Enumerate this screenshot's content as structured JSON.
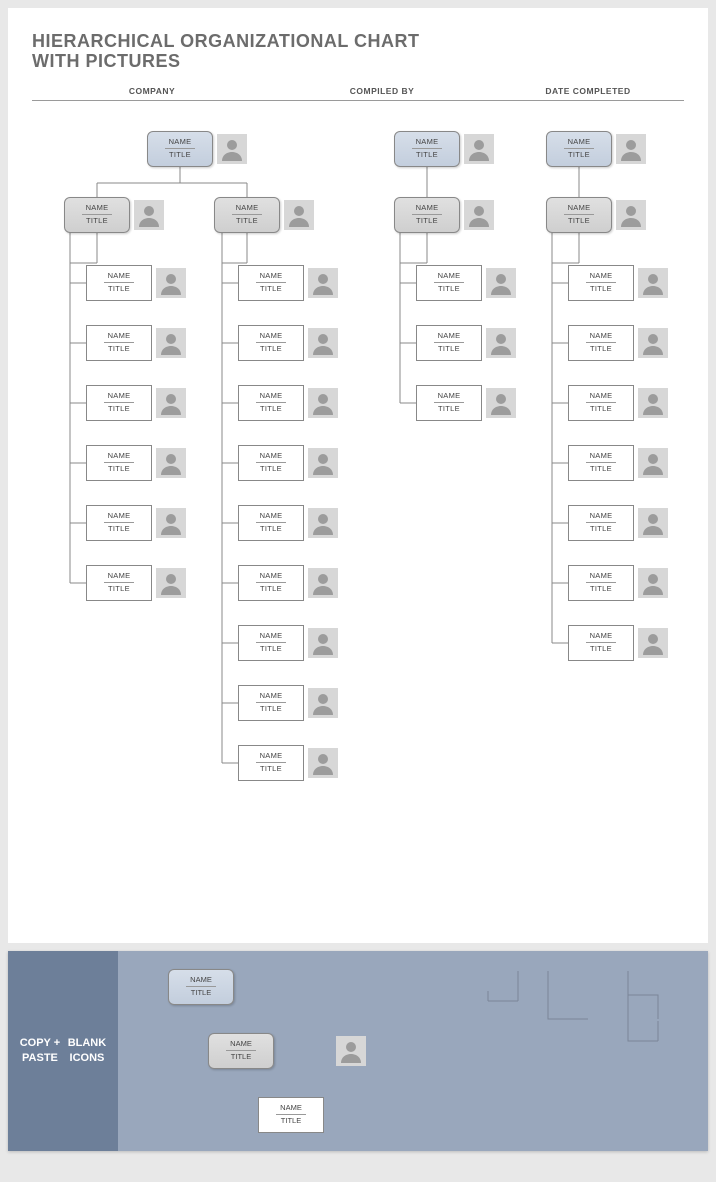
{
  "doc": {
    "title_line1": "HIERARCHICAL ORGANIZATIONAL CHART",
    "title_line2": "WITH PICTURES"
  },
  "headers": {
    "company": "COMPANY",
    "compiled_by": "COMPILED BY",
    "date_completed": "DATE COMPLETED"
  },
  "labels": {
    "name_ph": "NAME",
    "title_ph": "TITLE"
  },
  "palette": {
    "label_line1": "COPY + PASTE",
    "label_line2": "BLANK ICONS"
  },
  "chart_data": {
    "type": "org-chart",
    "title": "Hierarchical Organizational Chart With Pictures",
    "trees": [
      {
        "root": {
          "name": "NAME",
          "title": "TITLE",
          "level": "top"
        },
        "children": [
          {
            "node": {
              "name": "NAME",
              "title": "TITLE",
              "level": "mid"
            },
            "children": [
              {
                "name": "NAME",
                "title": "TITLE"
              },
              {
                "name": "NAME",
                "title": "TITLE"
              },
              {
                "name": "NAME",
                "title": "TITLE"
              },
              {
                "name": "NAME",
                "title": "TITLE"
              },
              {
                "name": "NAME",
                "title": "TITLE"
              },
              {
                "name": "NAME",
                "title": "TITLE"
              }
            ]
          },
          {
            "node": {
              "name": "NAME",
              "title": "TITLE",
              "level": "mid"
            },
            "children": [
              {
                "name": "NAME",
                "title": "TITLE"
              },
              {
                "name": "NAME",
                "title": "TITLE"
              },
              {
                "name": "NAME",
                "title": "TITLE"
              },
              {
                "name": "NAME",
                "title": "TITLE"
              },
              {
                "name": "NAME",
                "title": "TITLE"
              },
              {
                "name": "NAME",
                "title": "TITLE"
              },
              {
                "name": "NAME",
                "title": "TITLE"
              },
              {
                "name": "NAME",
                "title": "TITLE"
              },
              {
                "name": "NAME",
                "title": "TITLE"
              }
            ]
          }
        ]
      },
      {
        "root": {
          "name": "NAME",
          "title": "TITLE",
          "level": "top"
        },
        "children": [
          {
            "node": {
              "name": "NAME",
              "title": "TITLE",
              "level": "mid"
            },
            "children": [
              {
                "name": "NAME",
                "title": "TITLE"
              },
              {
                "name": "NAME",
                "title": "TITLE"
              },
              {
                "name": "NAME",
                "title": "TITLE"
              }
            ]
          }
        ]
      },
      {
        "root": {
          "name": "NAME",
          "title": "TITLE",
          "level": "top"
        },
        "children": [
          {
            "node": {
              "name": "NAME",
              "title": "TITLE",
              "level": "mid"
            },
            "children": [
              {
                "name": "NAME",
                "title": "TITLE"
              },
              {
                "name": "NAME",
                "title": "TITLE"
              },
              {
                "name": "NAME",
                "title": "TITLE"
              },
              {
                "name": "NAME",
                "title": "TITLE"
              },
              {
                "name": "NAME",
                "title": "TITLE"
              },
              {
                "name": "NAME",
                "title": "TITLE"
              },
              {
                "name": "NAME",
                "title": "TITLE"
              }
            ]
          }
        ]
      }
    ]
  }
}
